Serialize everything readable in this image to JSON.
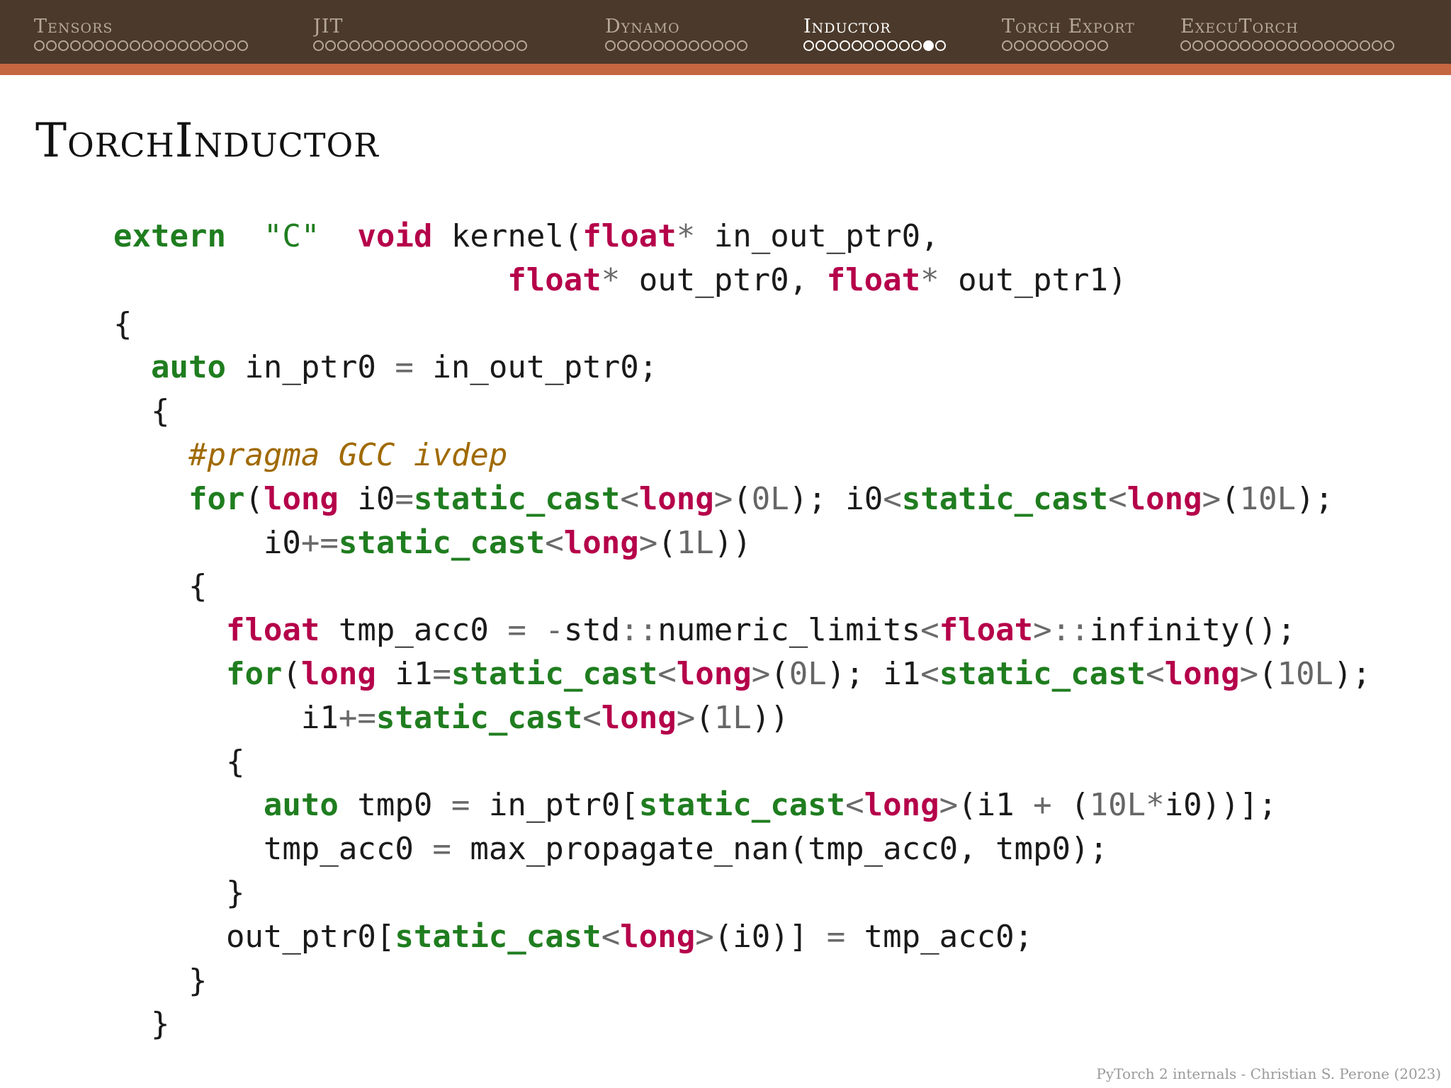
{
  "nav": {
    "sections": [
      {
        "label": "Tensors",
        "dots": 18,
        "current": -1,
        "active": false
      },
      {
        "label": "JIT",
        "dots": 18,
        "current": -1,
        "active": false
      },
      {
        "label": "Dynamo",
        "dots": 12,
        "current": -1,
        "active": false
      },
      {
        "label": "Inductor",
        "dots": 12,
        "current": 10,
        "active": true
      },
      {
        "label": "Torch Export",
        "dots": 9,
        "current": -1,
        "active": false
      },
      {
        "label": "ExecuTorch",
        "dots": 18,
        "current": -1,
        "active": false
      }
    ]
  },
  "slide": {
    "title": "TorchInductor"
  },
  "code": {
    "lines": [
      [
        [
          "kw",
          "extern"
        ],
        [
          "",
          "  "
        ],
        [
          "str",
          "\"C\""
        ],
        [
          "",
          "  "
        ],
        [
          "ty",
          "void"
        ],
        [
          "",
          " kernel("
        ],
        [
          "ty",
          "float"
        ],
        [
          "op",
          "*"
        ],
        [
          "",
          " in_out_ptr0,"
        ]
      ],
      [
        [
          "",
          "                     "
        ],
        [
          "ty",
          "float"
        ],
        [
          "op",
          "*"
        ],
        [
          "",
          " out_ptr0, "
        ],
        [
          "ty",
          "float"
        ],
        [
          "op",
          "*"
        ],
        [
          "",
          " out_ptr1)"
        ]
      ],
      [
        [
          "",
          "{"
        ]
      ],
      [
        [
          "",
          "  "
        ],
        [
          "kw",
          "auto"
        ],
        [
          "",
          " in_ptr0 "
        ],
        [
          "op",
          "="
        ],
        [
          "",
          " in_out_ptr0;"
        ]
      ],
      [
        [
          "",
          "  {"
        ]
      ],
      [
        [
          "",
          "    "
        ],
        [
          "cm",
          "#pragma GCC ivdep"
        ]
      ],
      [
        [
          "",
          "    "
        ],
        [
          "kw",
          "for"
        ],
        [
          "",
          "("
        ],
        [
          "ty",
          "long"
        ],
        [
          "",
          " i0"
        ],
        [
          "op",
          "="
        ],
        [
          "kw",
          "static_cast"
        ],
        [
          "op",
          "<"
        ],
        [
          "ty",
          "long"
        ],
        [
          "op",
          ">"
        ],
        [
          "",
          "("
        ],
        [
          "num",
          "0L"
        ],
        [
          "",
          "); i0"
        ],
        [
          "op",
          "<"
        ],
        [
          "kw",
          "static_cast"
        ],
        [
          "op",
          "<"
        ],
        [
          "ty",
          "long"
        ],
        [
          "op",
          ">"
        ],
        [
          "",
          "("
        ],
        [
          "num",
          "10L"
        ],
        [
          "",
          ");"
        ]
      ],
      [
        [
          "",
          "        i0"
        ],
        [
          "op",
          "+="
        ],
        [
          "kw",
          "static_cast"
        ],
        [
          "op",
          "<"
        ],
        [
          "ty",
          "long"
        ],
        [
          "op",
          ">"
        ],
        [
          "",
          "("
        ],
        [
          "num",
          "1L"
        ],
        [
          "",
          "))"
        ]
      ],
      [
        [
          "",
          "    {"
        ]
      ],
      [
        [
          "",
          "      "
        ],
        [
          "ty",
          "float"
        ],
        [
          "",
          " tmp_acc0 "
        ],
        [
          "op",
          "="
        ],
        [
          "",
          " "
        ],
        [
          "op",
          "-"
        ],
        [
          "",
          "std"
        ],
        [
          "op",
          "::"
        ],
        [
          "",
          "numeric_limits"
        ],
        [
          "op",
          "<"
        ],
        [
          "ty",
          "float"
        ],
        [
          "op",
          ">::"
        ],
        [
          "",
          "infinity();"
        ]
      ],
      [
        [
          "",
          "      "
        ],
        [
          "kw",
          "for"
        ],
        [
          "",
          "("
        ],
        [
          "ty",
          "long"
        ],
        [
          "",
          " i1"
        ],
        [
          "op",
          "="
        ],
        [
          "kw",
          "static_cast"
        ],
        [
          "op",
          "<"
        ],
        [
          "ty",
          "long"
        ],
        [
          "op",
          ">"
        ],
        [
          "",
          "("
        ],
        [
          "num",
          "0L"
        ],
        [
          "",
          "); i1"
        ],
        [
          "op",
          "<"
        ],
        [
          "kw",
          "static_cast"
        ],
        [
          "op",
          "<"
        ],
        [
          "ty",
          "long"
        ],
        [
          "op",
          ">"
        ],
        [
          "",
          "("
        ],
        [
          "num",
          "10L"
        ],
        [
          "",
          ");"
        ]
      ],
      [
        [
          "",
          "          i1"
        ],
        [
          "op",
          "+="
        ],
        [
          "kw",
          "static_cast"
        ],
        [
          "op",
          "<"
        ],
        [
          "ty",
          "long"
        ],
        [
          "op",
          ">"
        ],
        [
          "",
          "("
        ],
        [
          "num",
          "1L"
        ],
        [
          "",
          "))"
        ]
      ],
      [
        [
          "",
          "      {"
        ]
      ],
      [
        [
          "",
          "        "
        ],
        [
          "kw",
          "auto"
        ],
        [
          "",
          " tmp0 "
        ],
        [
          "op",
          "="
        ],
        [
          "",
          " in_ptr0["
        ],
        [
          "kw",
          "static_cast"
        ],
        [
          "op",
          "<"
        ],
        [
          "ty",
          "long"
        ],
        [
          "op",
          ">"
        ],
        [
          "",
          "(i1 "
        ],
        [
          "op",
          "+"
        ],
        [
          "",
          " ("
        ],
        [
          "num",
          "10L"
        ],
        [
          "op",
          "*"
        ],
        [
          "",
          "i0))];"
        ]
      ],
      [
        [
          "",
          "        tmp_acc0 "
        ],
        [
          "op",
          "="
        ],
        [
          "",
          " max_propagate_nan(tmp_acc0, tmp0);"
        ]
      ],
      [
        [
          "",
          "      }"
        ]
      ],
      [
        [
          "",
          "      out_ptr0["
        ],
        [
          "kw",
          "static_cast"
        ],
        [
          "op",
          "<"
        ],
        [
          "ty",
          "long"
        ],
        [
          "op",
          ">"
        ],
        [
          "",
          "(i0)] "
        ],
        [
          "op",
          "="
        ],
        [
          "",
          " tmp_acc0;"
        ]
      ],
      [
        [
          "",
          "    }"
        ]
      ],
      [
        [
          "",
          "  }"
        ]
      ]
    ]
  },
  "footer": {
    "text": "PyTorch 2 internals - Christian S. Perone (2023)"
  },
  "colors": {
    "topbar": "#4b3a2b",
    "accent": "#c4663f",
    "keyword": "#1f7d1f",
    "type": "#b5004a",
    "comment": "#a06a00"
  }
}
